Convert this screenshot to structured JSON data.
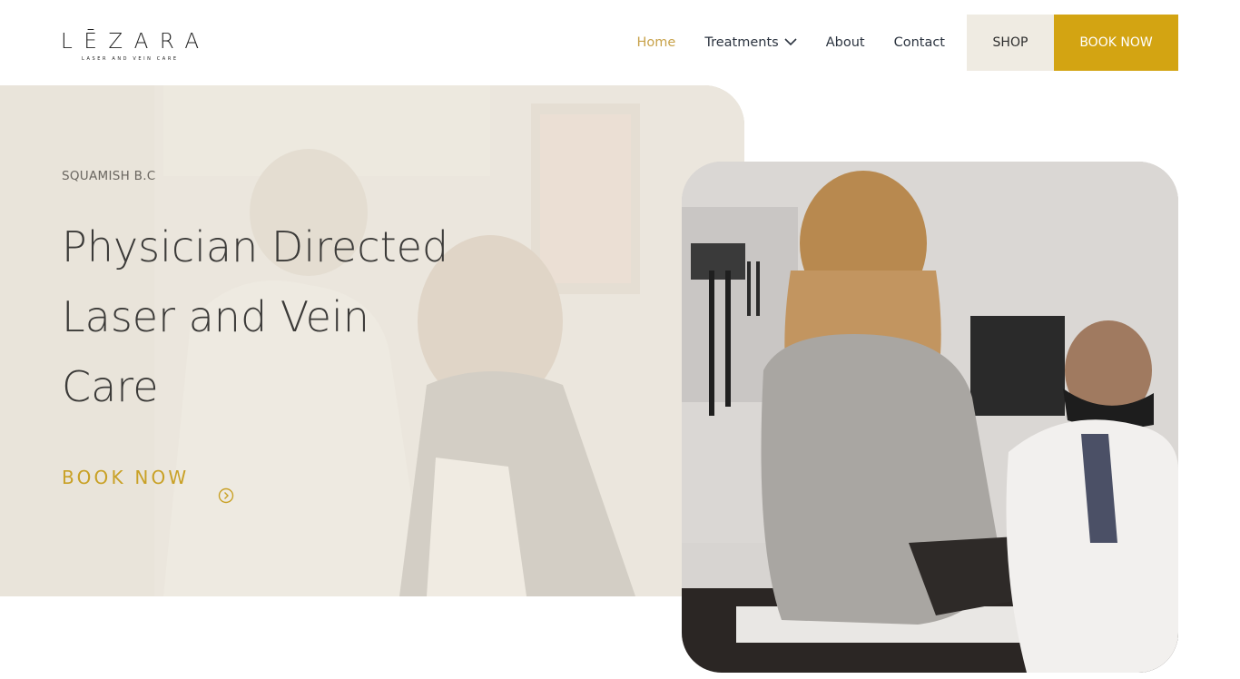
{
  "brand": {
    "name": "LĒZARA",
    "tagline": "LASER AND VEIN CARE"
  },
  "nav": {
    "items": [
      {
        "label": "Home",
        "active": true
      },
      {
        "label": "Treatments",
        "has_dropdown": true
      },
      {
        "label": "About"
      },
      {
        "label": "Contact"
      }
    ],
    "shop_label": "SHOP",
    "book_label": "BOOK NOW"
  },
  "hero": {
    "location": "SQUAMISH B.C",
    "title_lines": [
      "Physician Directed",
      "Laser and Vein",
      "Care"
    ],
    "cta_label": "BOOK NOW",
    "cta_icon": "circle-chevron-right-icon"
  },
  "colors": {
    "accent_gold": "#d3a412",
    "nav_active": "#c8a24a",
    "shop_bg": "#efebe2",
    "hero_bg": "#f0ece3",
    "text_dark": "#3b3a38"
  }
}
